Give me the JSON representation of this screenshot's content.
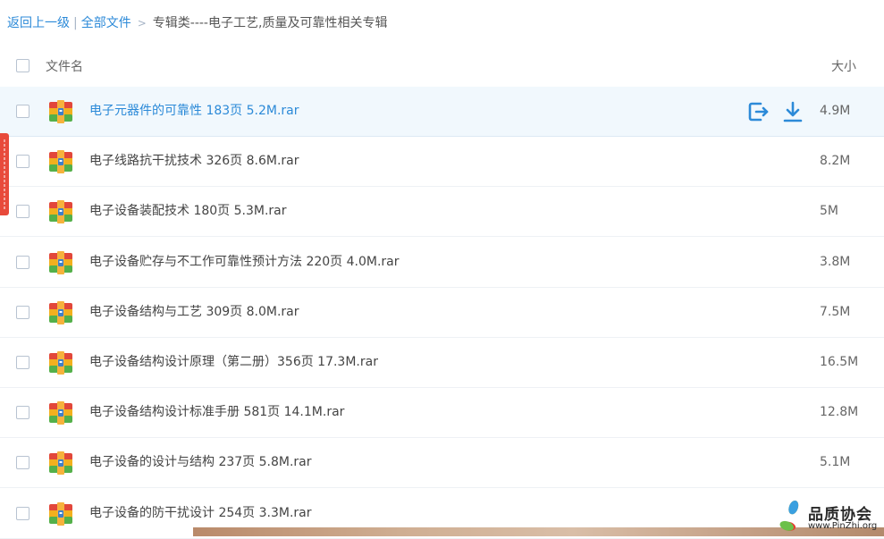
{
  "breadcrumb": {
    "back": "返回上一级",
    "separator": "|",
    "all_files": "全部文件",
    "arrow": ">",
    "current": "专辑类----电子工艺,质量及可靠性相关专辑"
  },
  "header": {
    "name": "文件名",
    "size": "大小"
  },
  "files": [
    {
      "name": "电子元器件的可靠性 183页 5.2M.rar",
      "size": "4.9M",
      "icon": "rar-archive-icon"
    },
    {
      "name": "电子线路抗干扰技术 326页 8.6M.rar",
      "size": "8.2M",
      "icon": "rar-archive-icon"
    },
    {
      "name": "电子设备装配技术 180页 5.3M.rar",
      "size": "5M",
      "icon": "rar-archive-icon"
    },
    {
      "name": "电子设备贮存与不工作可靠性预计方法 220页 4.0M.rar",
      "size": "3.8M",
      "icon": "rar-archive-icon"
    },
    {
      "name": "电子设备结构与工艺 309页 8.0M.rar",
      "size": "7.5M",
      "icon": "rar-archive-icon"
    },
    {
      "name": "电子设备结构设计原理（第二册）356页 17.3M.rar",
      "size": "16.5M",
      "icon": "rar-archive-icon"
    },
    {
      "name": "电子设备结构设计标准手册 581页 14.1M.rar",
      "size": "12.8M",
      "icon": "rar-archive-icon"
    },
    {
      "name": "电子设备的设计与结构 237页 5.8M.rar",
      "size": "5.1M",
      "icon": "rar-archive-icon"
    },
    {
      "name": "电子设备的防干扰设计 254页 3.3M.rar",
      "size": "",
      "icon": "rar-archive-icon"
    }
  ],
  "actions": {
    "share_icon": "share-icon",
    "download_icon": "download-icon"
  },
  "watermark": {
    "name": "品质协会",
    "url": "www.PinZhi.org"
  },
  "colors": {
    "accent": "#2c8ad8",
    "highlight_row": "#f1f8fd",
    "side_tab": "#e84a3b"
  }
}
